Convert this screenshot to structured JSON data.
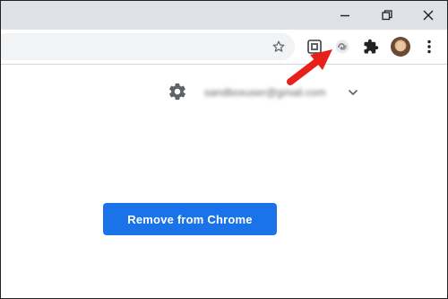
{
  "window": {
    "controls": [
      {
        "icon": "minimize-icon"
      },
      {
        "icon": "restore-icon"
      },
      {
        "icon": "close-icon"
      }
    ]
  },
  "toolbar": {
    "icons": [
      {
        "icon": "star-bookmark-icon"
      },
      {
        "icon": "extension-icon"
      },
      {
        "icon": "extension-icon"
      },
      {
        "icon": "puzzle-extensions-icon"
      },
      {
        "icon": "profile-avatar-icon"
      },
      {
        "icon": "more-menu-icon"
      }
    ]
  },
  "header": {
    "email": "sandboxuser@gmail.com",
    "settings_icon": "gear-icon",
    "account_chevron_icon": "chevron-down-icon"
  },
  "main": {
    "remove_button_label": "Remove from Chrome"
  },
  "annotation": {
    "arrow_color": "#e8201a",
    "arrow_icon": "arrow-pointer-icon"
  },
  "colors": {
    "titlebar": "#dee1e6",
    "omnibox": "#f1f3f4",
    "primary_button": "#1a73e8"
  }
}
